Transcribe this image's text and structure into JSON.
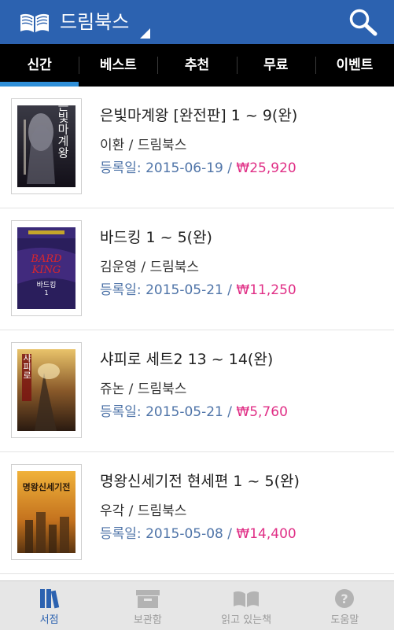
{
  "header": {
    "title": "드림북스",
    "logo_icon": "open-book-icon",
    "search_icon": "search-icon",
    "background": "#2c62b0"
  },
  "tabs": [
    {
      "label": "신간",
      "active": true
    },
    {
      "label": "베스트",
      "active": false
    },
    {
      "label": "추천",
      "active": false
    },
    {
      "label": "무료",
      "active": false
    },
    {
      "label": "이벤트",
      "active": false
    }
  ],
  "books": [
    {
      "title": "은빛마계왕 [완전판] 1 ~ 9(완)",
      "author_publisher": "이환 / 드림북스",
      "reg_label": "등록일:",
      "reg_date": "2015-06-19",
      "price": "₩25,920",
      "cover_text": "은빛마계왕"
    },
    {
      "title": "바드킹 1 ~ 5(완)",
      "author_publisher": "김운영 / 드림북스",
      "reg_label": "등록일:",
      "reg_date": "2015-05-21",
      "price": "₩11,250",
      "cover_text": "바드킹"
    },
    {
      "title": "샤피로 세트2 13 ~ 14(완)",
      "author_publisher": "쥬논 / 드림북스",
      "reg_label": "등록일:",
      "reg_date": "2015-05-21",
      "price": "₩5,760",
      "cover_text": "샤피로"
    },
    {
      "title": "명왕신세기전 현세편 1 ~ 5(완)",
      "author_publisher": "우각 / 드림북스",
      "reg_label": "등록일:",
      "reg_date": "2015-05-08",
      "price": "₩14,400",
      "cover_text": "명왕신세기전"
    }
  ],
  "bottom_nav": [
    {
      "label": "서점",
      "icon": "bookstore-icon",
      "active": true
    },
    {
      "label": "보관함",
      "icon": "storage-box-icon",
      "active": false
    },
    {
      "label": "읽고 있는책",
      "icon": "open-book-icon",
      "active": false
    },
    {
      "label": "도움말",
      "icon": "help-icon",
      "active": false
    }
  ],
  "colors": {
    "accent": "#2c62b0",
    "tab_indicator": "#2f8fd8",
    "meta": "#4f74a8",
    "price": "#e02f86"
  }
}
